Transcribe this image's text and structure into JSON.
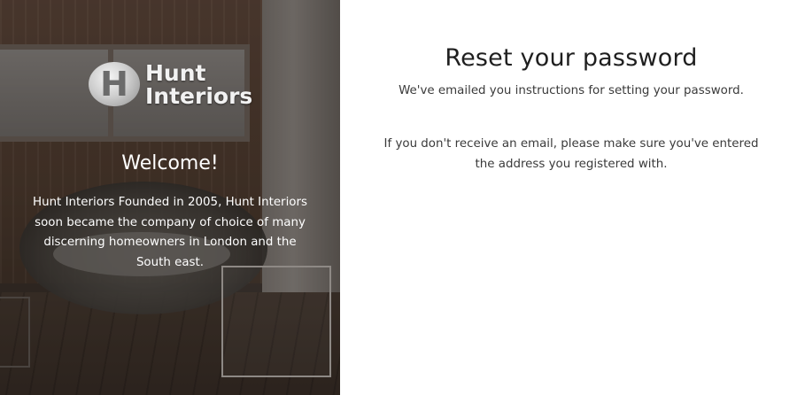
{
  "brand": {
    "logo_line_1": "Hunt",
    "logo_line_2": "Interiors",
    "emblem_letter": "H"
  },
  "left_panel": {
    "title": "Welcome!",
    "description": "Hunt Interiors Founded in 2005, Hunt Interiors soon became the company of choice of many discerning homeowners in London and the South east."
  },
  "right_panel": {
    "title": "Reset your password",
    "message_1": "We've emailed you instructions for setting your password.",
    "message_2": "If you don't receive an email, please make sure you've entered the address you registered with."
  },
  "colors": {
    "background": "#ffffff",
    "heading": "#1f1f1f",
    "body_text": "#3a3a3a",
    "overlay_text": "#ffffff"
  }
}
